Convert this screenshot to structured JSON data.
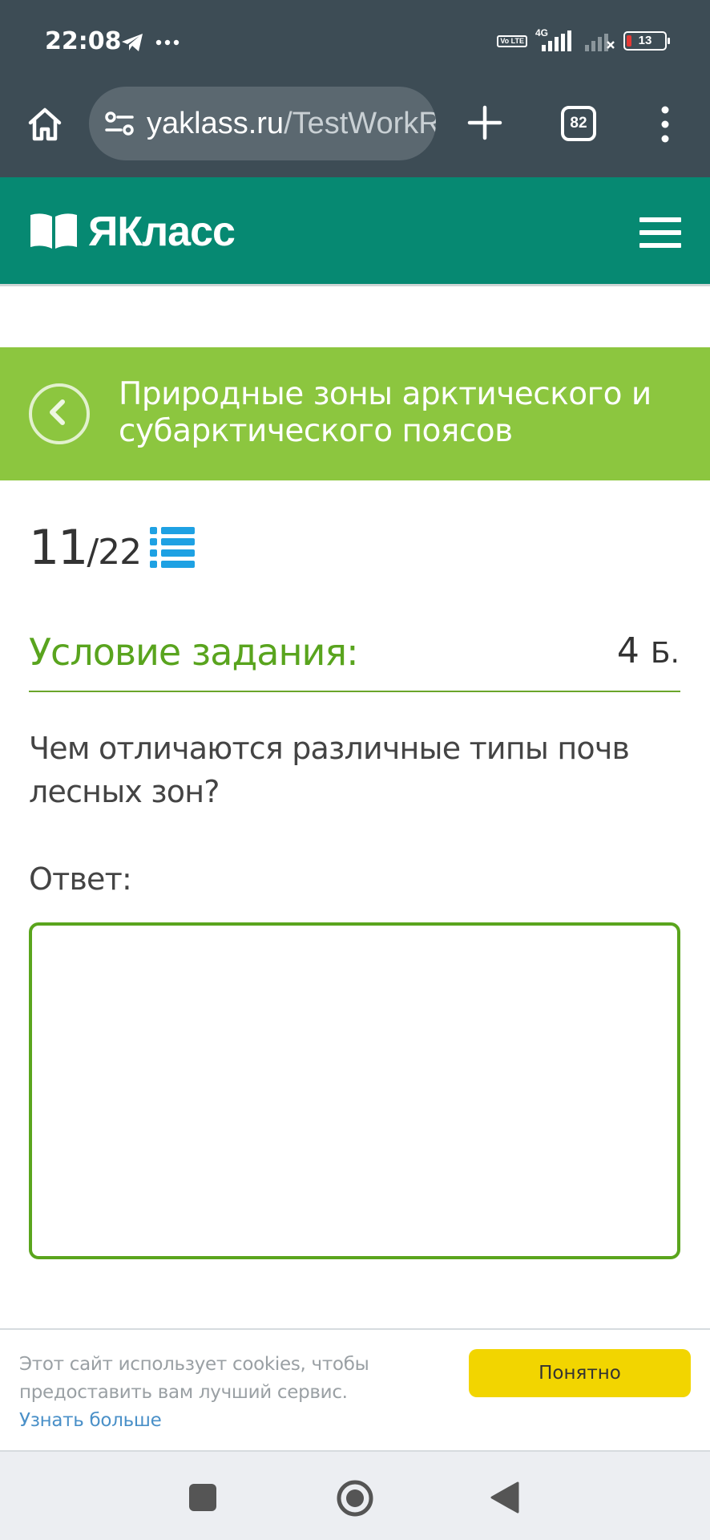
{
  "status_bar": {
    "time": "22:08",
    "left_icons": [
      "telegram-icon",
      "more-notifications-icon"
    ],
    "volte_label": "Vo LTE",
    "network_label": "4G",
    "battery_level": "13"
  },
  "browser": {
    "url_domain": "yaklass.ru",
    "url_path": "/TestWorkR",
    "tab_count": "82",
    "icons": [
      "home-icon",
      "site-settings-icon",
      "new-tab-icon",
      "tabs-icon",
      "more-menu-icon"
    ]
  },
  "site": {
    "logo_text": "ЯКласс",
    "menu_icon": "hamburger-icon"
  },
  "topic": {
    "title": "Природные зоны арктического и субарктического поясов",
    "back_icon": "chevron-left-icon"
  },
  "progress": {
    "current": "11",
    "total": "/22",
    "list_icon": "task-list-icon"
  },
  "task": {
    "condition_title": "Условие задания:",
    "points_value": "4",
    "points_unit": "Б.",
    "question": "Чем отличаются различные типы почв лесных зон?",
    "answer_label": "Ответ:",
    "answer_value": ""
  },
  "cookie": {
    "text": "Этот сайт использует cookies, чтобы предоставить вам лучший сервис.",
    "link": "Узнать больше",
    "button": "Понятно"
  },
  "colors": {
    "status_bg": "#3d4c55",
    "header_green": "#068972",
    "banner_green": "#8cc63f",
    "accent_green": "#59a41e",
    "list_icon_blue": "#1ea1e3",
    "cookie_button": "#f2d500"
  }
}
